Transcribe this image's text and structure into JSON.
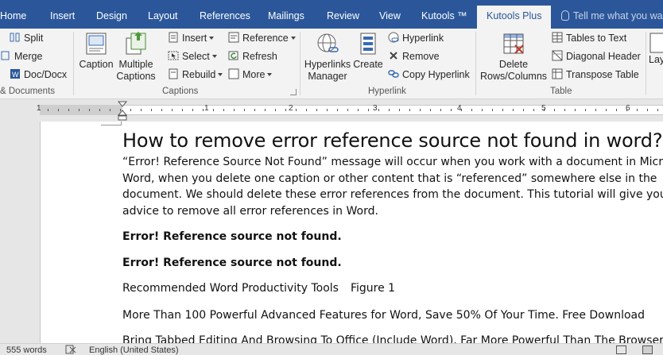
{
  "tabs": [
    "Home",
    "Insert",
    "Design",
    "Layout",
    "References",
    "Mailings",
    "Review",
    "View",
    "Kutools ™",
    "Kutools Plus"
  ],
  "tell_me": "Tell me what you want to do",
  "ribbon": {
    "documents_group": {
      "split": "Split",
      "merge": "Merge",
      "doc_docx": "Doc/Docx",
      "label": "& Documents"
    },
    "captions_group": {
      "caption": "Caption",
      "multiple_captions_line1": "Multiple",
      "multiple_captions_line2": "Captions",
      "insert": "Insert",
      "select": "Select",
      "rebuild": "Rebuild",
      "reference": "Reference",
      "refresh": "Refresh",
      "more": "More",
      "label": "Captions"
    },
    "hyperlink_group": {
      "hyperlinks_manager_line1": "Hyperlinks",
      "hyperlinks_manager_line2": "Manager",
      "create": "Create",
      "hyperlink": "Hyperlink",
      "remove": "Remove",
      "copy_hyperlink": "Copy Hyperlink",
      "label": "Hyperlink"
    },
    "table_group": {
      "delete_rows_cols_line1": "Delete",
      "delete_rows_cols_line2": "Rows/Columns",
      "tables_to_text": "Tables to Text",
      "diagonal_header": "Diagonal Header",
      "transpose_table": "Transpose Table",
      "label": "Table"
    },
    "layout_partial": "Lay"
  },
  "ruler_numbers": [
    "1",
    "1",
    "2",
    "3",
    "4",
    "5",
    "6"
  ],
  "document": {
    "title": "How to remove error reference source not found in word?",
    "intro_lines": [
      "“Error! Reference Source Not Found” message will occur when you work with a document in Microsoft",
      "Word, when you delete one caption or other content that is “referenced” somewhere else in the",
      "document. We should delete these error references from the document. This tutorial will give you some",
      "advice to remove all error references in Word."
    ],
    "error_line_1": "Error! Reference source not found.",
    "error_line_2": "Error! Reference source not found.",
    "recommended": "Recommended Word Productivity Tools",
    "figure": "Figure 1",
    "more_than": "More Than 100 Powerful Advanced Features for Word, Save 50% Of Your Time. Free Download",
    "cut_line": "Bring Tabbed Editing And Browsing To Office (Include Word), Far More Powerful Than The Browser's"
  },
  "status": {
    "words": "555 words",
    "language": "English (United States)"
  },
  "colors": {
    "tab_bar": "#2b579a",
    "ribbon": "#f3f3f3",
    "canvas": "#e6e6e6"
  }
}
